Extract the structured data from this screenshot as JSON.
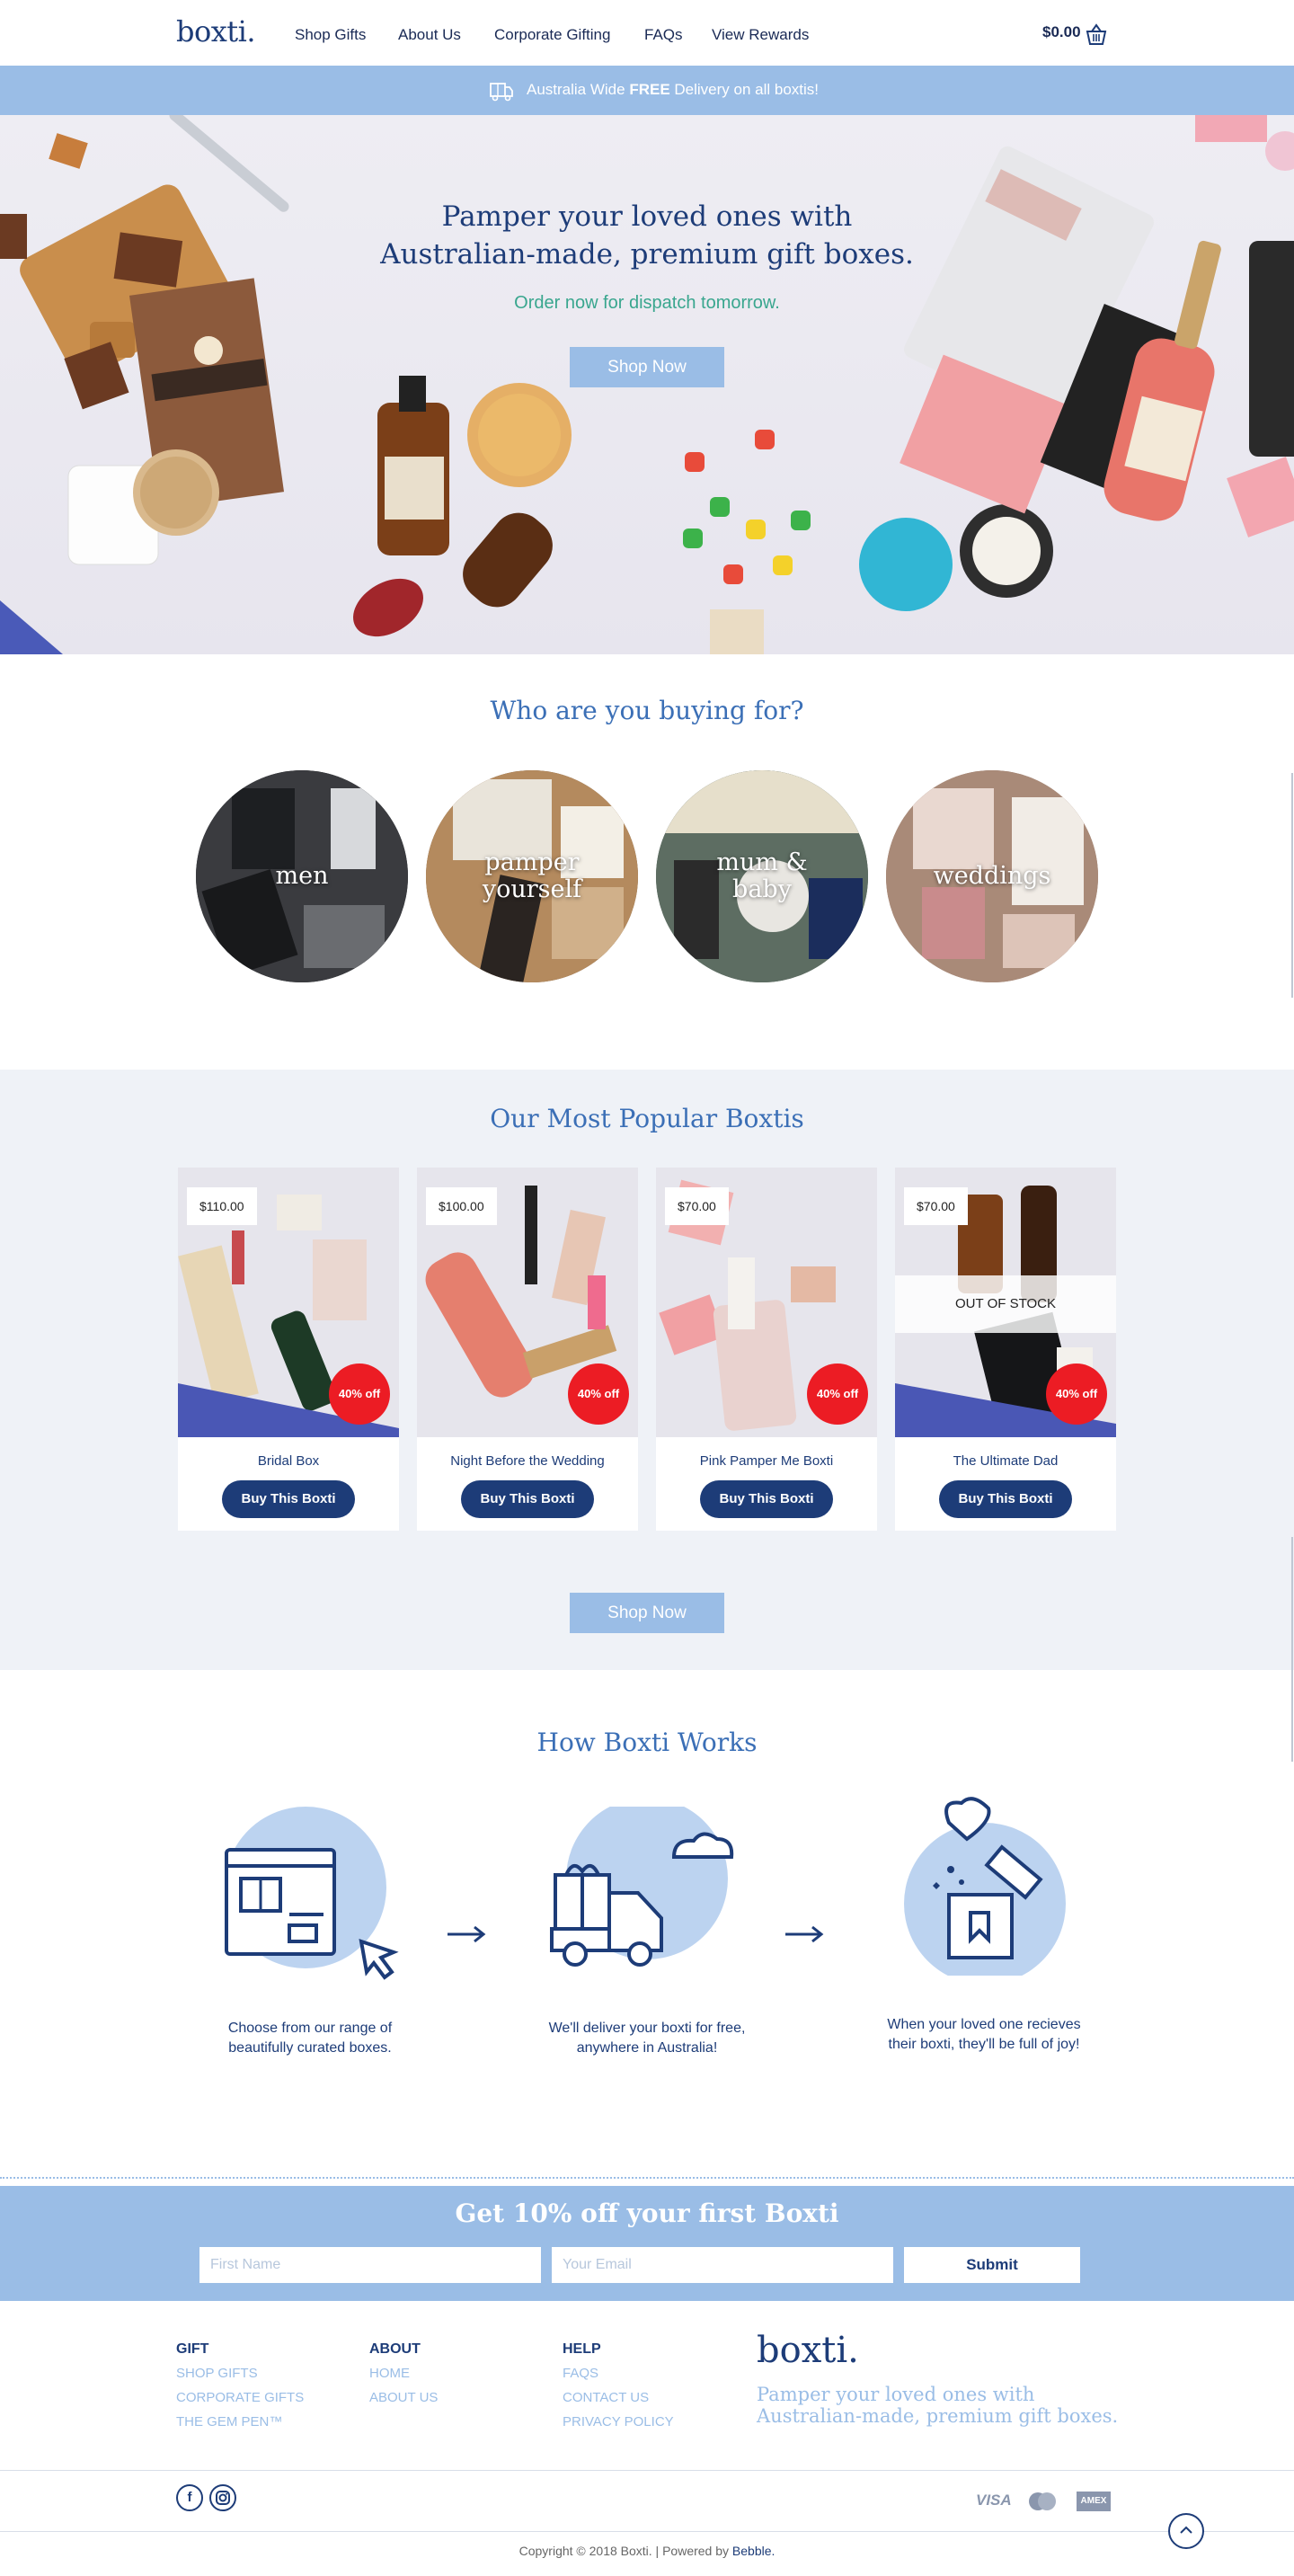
{
  "header": {
    "logo": "boxti.",
    "nav": [
      "Shop Gifts",
      "About Us",
      "Corporate Gifting",
      "FAQs",
      "View Rewards"
    ],
    "cart_total": "$0.00"
  },
  "banner": {
    "text_before": "Australia Wide ",
    "text_bold": "FREE",
    "text_after": " Delivery on all boxtis!"
  },
  "hero": {
    "title_line1": "Pamper your loved ones with",
    "title_line2": "Australian-made, premium gift boxes.",
    "subtitle": "Order now for dispatch tomorrow.",
    "button": "Shop Now"
  },
  "who": {
    "title": "Who are you buying for?",
    "categories": [
      {
        "line1": "men",
        "line2": ""
      },
      {
        "line1": "pamper",
        "line2": "yourself"
      },
      {
        "line1": "mum &",
        "line2": "baby"
      },
      {
        "line1": "weddings",
        "line2": ""
      }
    ]
  },
  "popular": {
    "title": "Our Most Popular Boxtis",
    "products": [
      {
        "price": "$110.00",
        "name": "Bridal Box",
        "badge": "40% off",
        "buy": "Buy This Boxti",
        "status": ""
      },
      {
        "price": "$100.00",
        "name": "Night Before the Wedding",
        "badge": "40% off",
        "buy": "Buy This Boxti",
        "status": ""
      },
      {
        "price": "$70.00",
        "name": "Pink Pamper Me Boxti",
        "badge": "40% off",
        "buy": "Buy This Boxti",
        "status": ""
      },
      {
        "price": "$70.00",
        "name": "The Ultimate Dad",
        "badge": "40% off",
        "buy": "Buy This Boxti",
        "status": "OUT OF STOCK"
      }
    ],
    "button": "Shop Now"
  },
  "how": {
    "title": "How Boxti Works",
    "steps": [
      {
        "line1": "Choose from our range of",
        "line2": "beautifully curated boxes.",
        "icon": "browser-gift-icon"
      },
      {
        "line1": "We'll deliver your boxti for free,",
        "line2": "anywhere in Australia!",
        "icon": "delivery-truck-icon"
      },
      {
        "line1": "When your loved one recieves",
        "line2": "their boxti, they'll be full of joy!",
        "icon": "open-gift-heart-icon"
      }
    ]
  },
  "newsletter": {
    "title": "Get 10% off your first Boxti",
    "first_name_placeholder": "First Name",
    "email_placeholder": "Your Email",
    "submit": "Submit"
  },
  "footer": {
    "columns": [
      {
        "heading": "GIFT",
        "links": [
          "SHOP GIFTS",
          "CORPORATE GIFTS",
          "THE GEM PEN™"
        ]
      },
      {
        "heading": "ABOUT",
        "links": [
          "HOME",
          "ABOUT US"
        ]
      },
      {
        "heading": "HELP",
        "links": [
          "FAQS",
          "CONTACT US",
          "PRIVACY POLICY"
        ]
      }
    ],
    "logo": "boxti.",
    "tagline_line1": "Pamper your loved ones with",
    "tagline_line2": "Australian-made, premium gift boxes.",
    "copyright": "Copyright © 2018 Boxti. | Powered by ",
    "powered_by": "Bebble.",
    "payments": [
      "VISA",
      "mastercard",
      "AMEX"
    ]
  },
  "colors": {
    "navy": "#1d3c78",
    "accent_blue": "#9abde6",
    "teal": "#39a68e",
    "sale_red": "#ec1c24",
    "section_grey": "#eff2f7"
  }
}
